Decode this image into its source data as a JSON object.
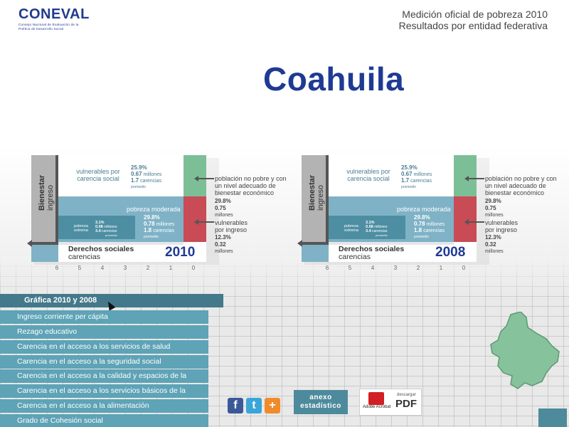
{
  "logo": {
    "text": "CONEVAL",
    "subtitle": "Consejo Nacional de Evaluación de la Política de Desarrollo Social"
  },
  "header": {
    "line1": "Medición oficial de pobreza 2010",
    "line2": "Resultados por entidad federativa"
  },
  "state_title": "Coahuila",
  "chart_labels": {
    "y_bold": "Bienestar",
    "y_sub": "ingreso",
    "x_bold": "Derechos sociales",
    "x_sub": "carencias",
    "vulnerables_carencia": "vulnerables por carencia social",
    "pobreza_moderada": "pobreza moderada",
    "pobreza_extrema": "pobreza extrema",
    "no_pobre": "población no pobre y con un nivel adecuado de bienestar económico",
    "vulnerables_ingreso": "vulnerables por ingreso",
    "millones": "millones",
    "carencias_word": "carencias",
    "promedio": "promedio"
  },
  "chart_data": [
    {
      "type": "table",
      "year": "2010",
      "x_ticks": [
        "6",
        "5",
        "4",
        "3",
        "2",
        "1",
        "0"
      ],
      "vulnerables_carencia": {
        "pct": "25.9%",
        "millones": "0.67",
        "carencias": "1.7"
      },
      "pobreza_moderada": {
        "pct": "29.8%",
        "millones": "0.78",
        "carencias": "1.8"
      },
      "pobreza_extrema": {
        "pct": "3.1%",
        "millones": "0.08",
        "carencias": "3.4"
      },
      "no_pobre": {
        "pct": "29.8%",
        "millones": "0.75"
      },
      "vulnerables_ingreso": {
        "pct": "12.3%",
        "millones": "0.32"
      }
    },
    {
      "type": "table",
      "year": "2008",
      "x_ticks": [
        "6",
        "5",
        "4",
        "3",
        "2",
        "1",
        "0"
      ],
      "vulnerables_carencia": {
        "pct": "25.9%",
        "millones": "0.67",
        "carencias": "1.7"
      },
      "pobreza_moderada": {
        "pct": "29.8%",
        "millones": "0.78",
        "carencias": "1.8"
      },
      "pobreza_extrema": {
        "pct": "3.1%",
        "millones": "0.08",
        "carencias": "3.4"
      },
      "no_pobre": {
        "pct": "29.8%",
        "millones": "0.75"
      },
      "vulnerables_ingreso": {
        "pct": "12.3%",
        "millones": "0.32"
      }
    }
  ],
  "menu": {
    "active": "Gráfica 2010 y 2008",
    "items": [
      "Ingreso corriente per cápita",
      "Rezago educativo",
      "Carencia en el acceso a los servicios de salud",
      "Carencia en el acceso a la seguridad social",
      "Carencia en el acceso a la calidad y espacios de la vivienda",
      "Carencia en el acceso a los servicios básicos de la vivienda",
      "Carencia en el acceso a la alimentación",
      "Grado de Cohesión social"
    ]
  },
  "social": {
    "facebook": "f",
    "twitter": "t",
    "plus": "+"
  },
  "anexo": {
    "line1": "anexo",
    "line2": "estadístico"
  },
  "pdf": {
    "brand": "Adobe Acrobat",
    "desc": "descargar",
    "label": "PDF"
  },
  "colors": {
    "accent_blue": "#1f3a93",
    "teal_menu": "#5ea3b6",
    "teal_dark": "#43798a",
    "green": "#7cbf97",
    "red": "#c84b55"
  }
}
